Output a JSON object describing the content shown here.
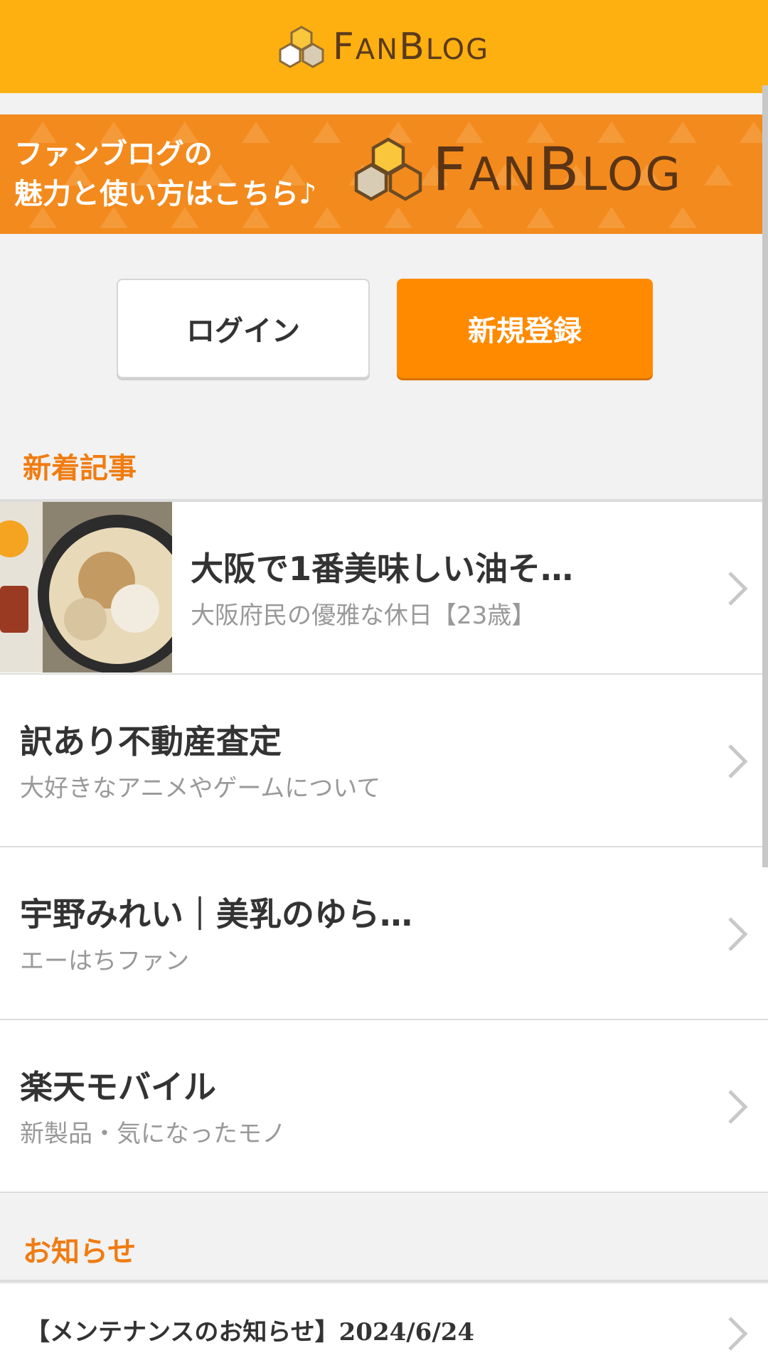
{
  "header": {
    "logo_text_f": "F",
    "logo_text_an": "AN",
    "logo_text_b": "B",
    "logo_text_log": "LOG"
  },
  "banner": {
    "line1": "ファンブログの",
    "line2": "魅力と使い方はこちら♪",
    "logo_f": "F",
    "logo_an": "AN",
    "logo_b": "B",
    "logo_log": "LOG"
  },
  "auth": {
    "login_label": "ログイン",
    "register_label": "新規登録"
  },
  "new_articles": {
    "section_title": "新着記事",
    "items": [
      {
        "title": "大阪で1番美味しい油そ…",
        "blog": "大阪府民の優雅な休日【23歳】"
      },
      {
        "title": "訳あり不動産査定",
        "blog": "大好きなアニメやゲームについて"
      },
      {
        "title": "宇野みれい｜美乳のゆら…",
        "blog": "エーはちファン"
      },
      {
        "title": "楽天モバイル",
        "blog": "新製品・気になったモノ"
      }
    ]
  },
  "news": {
    "section_title": "お知らせ",
    "items": [
      {
        "title": "【メンテナンスのお知らせ】2024/6/24"
      }
    ]
  },
  "colors": {
    "header": "#fdb010",
    "banner": "#f38a1d",
    "accent": "#ff8a00",
    "section_title": "#f07c12"
  }
}
